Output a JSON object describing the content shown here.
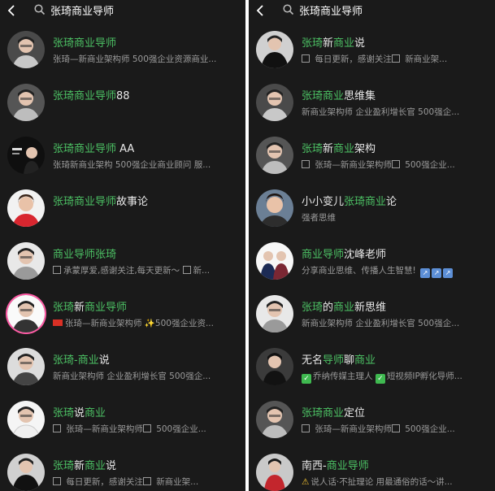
{
  "left": {
    "search_text": "张琦商业导师",
    "items": [
      {
        "t1": "张琦商业导师",
        "t2": "",
        "sub": "张琦—新商业架构师 500强企业资源商业..."
      },
      {
        "t1": "张琦商业导师",
        "t2": "88",
        "sub": ""
      },
      {
        "t1": "张琦商业导师",
        "t2": "AA",
        "sub": "张琦新商业架构 500强企业商业顾问 服..."
      },
      {
        "t1": "张琦商业导师",
        "t2": "故事论",
        "sub": ""
      },
      {
        "t1": "商业导师张琦",
        "t2": "",
        "sub": "承蒙厚爱,感谢关注,每天更新～",
        "sub_tail": "新..."
      },
      {
        "t1a": "张琦",
        "t1b": "新",
        "t1c": "商业导师",
        "sub": "张琦—新商业架构师",
        "sub_tail": "500强企业资..."
      },
      {
        "t1a": "张琦",
        "t1b": "-",
        "t1c": "商业",
        "t1d": "说",
        "sub": "新商业架构师 企业盈利增长官 500强企..."
      },
      {
        "t1a": "张琦",
        "t1b": "说",
        "t1c": "商业",
        "sub": "张琦—新商业架构师",
        "sub_tail": "500强企业..."
      },
      {
        "t1a": "张琦",
        "t1b": "新",
        "t1c": "商业",
        "t1d": "说",
        "sub": "每日更新，感谢关注",
        "sub_tail": "新商业架..."
      }
    ]
  },
  "right": {
    "search_text": "张琦商业导师",
    "items": [
      {
        "t1a": "张琦",
        "t1b": "新",
        "t1c": "商业",
        "t1d": "说",
        "sub": "每日更新，感谢关注",
        "sub_tail": "新商业架..."
      },
      {
        "t1a": "张琦商业",
        "t1b": "思维集",
        "sub": "新商业架构师 企业盈利增长官 500强企..."
      },
      {
        "t1a": "张琦",
        "t1b": "新",
        "t1c": "商业",
        "t1d": "架构",
        "sub": "张琦—新商业架构师",
        "sub_tail": "500强企业..."
      },
      {
        "t1a": "小小变儿",
        "t1b": "张琦商业",
        "t1c": "论",
        "sub": "强者思维"
      },
      {
        "t1a": "商业导师",
        "t1b": "沈峰老师",
        "sub": "分享商业思维、传播人生智慧!"
      },
      {
        "t1a": "张琦",
        "t1b": "的",
        "t1c": "商业",
        "t1d": "新思维",
        "sub": "新商业架构师 企业盈利增长官 500强企..."
      },
      {
        "t1a": "无名",
        "t1b": "导师",
        "t1c": "聊",
        "t1d": "商业",
        "sub": "乔纳传媒主理人",
        "sub_tail": "短视频IP孵化导师..."
      },
      {
        "t1a": "张琦商业",
        "t1b": "定位",
        "sub": "张琦—新商业架构师",
        "sub_tail": "500强企业..."
      },
      {
        "t1a": "南西-",
        "t1b": "商业导师",
        "sub": "说人话·不扯理论 用最通俗的话～讲..."
      }
    ]
  },
  "colors": {
    "highlight": "#4cc164",
    "bg": "#1a1a1a",
    "text": "#e8e8e8",
    "sub": "#9a9a9a"
  }
}
